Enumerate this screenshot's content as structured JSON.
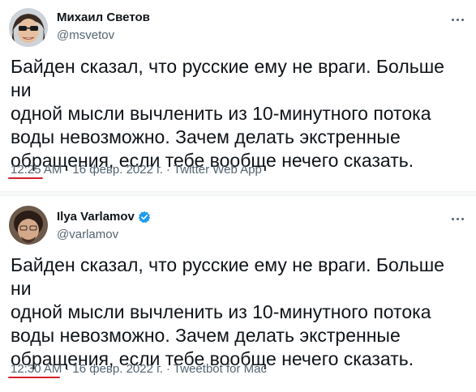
{
  "tweets": [
    {
      "author_name": "Михаил Светов",
      "handle": "@msvetov",
      "verified": false,
      "text": "Байден сказал, что русские ему не враги. Больше ни\nодной мысли вычленить из 10-минутного потока\nводы невозможно. Зачем делать экстренные\nобращения, если тебе вообще нечего сказать.",
      "time": "12:25 AM",
      "separator": "·",
      "date": "16 февр. 2022 г.",
      "client": "Twitter Web App"
    },
    {
      "author_name": "Ilya Varlamov",
      "handle": "@varlamov",
      "verified": true,
      "text": "Байден сказал, что русские ему не враги. Больше ни\nодной мысли вычленить из 10-минутного потока\nводы невозможно. Зачем делать экстренные\nобращения, если тебе вообще нечего сказать.",
      "time": "12:30 AM",
      "separator": "·",
      "date": "16 февр. 2022 г.",
      "client": "Tweetbot for Mac"
    }
  ],
  "colors": {
    "verified_badge": "#1d9bf0",
    "timestamp_underline": "#d6212a",
    "secondary_text": "#536471"
  }
}
